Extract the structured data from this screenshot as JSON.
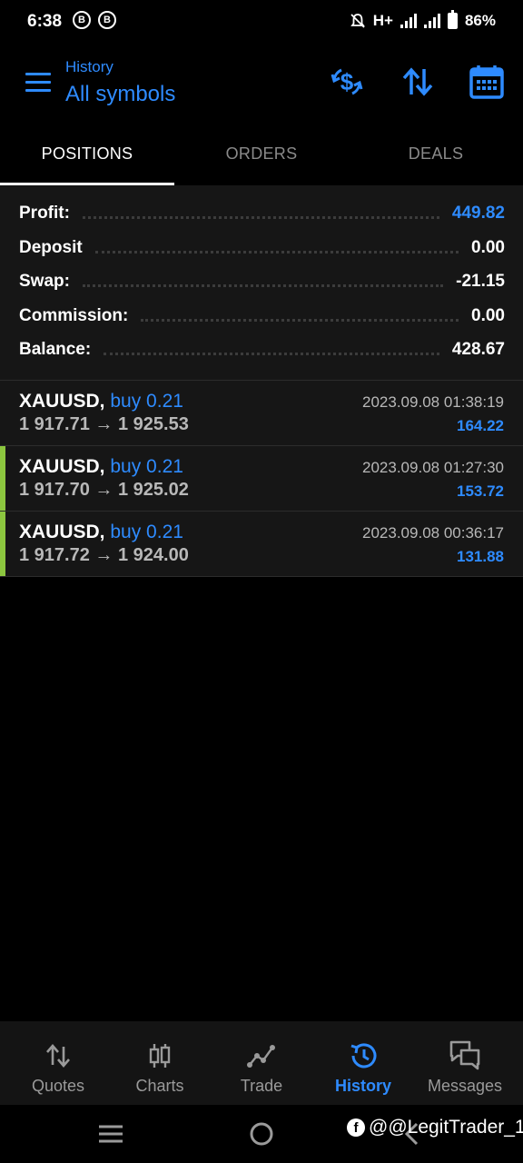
{
  "status_bar": {
    "time": "6:38",
    "badge_1": "B",
    "badge_2": "B",
    "network": "H+",
    "battery": "86%"
  },
  "header": {
    "subtitle": "History",
    "title": "All symbols",
    "icons": [
      "currency-exchange-icon",
      "sort-icon",
      "calendar-icon"
    ]
  },
  "tabs": [
    {
      "label": "POSITIONS",
      "active": true
    },
    {
      "label": "ORDERS",
      "active": false
    },
    {
      "label": "DEALS",
      "active": false
    }
  ],
  "summary": {
    "profit_label": "Profit:",
    "profit_value": "449.82",
    "deposit_label": "Deposit",
    "deposit_value": "0.00",
    "swap_label": "Swap:",
    "swap_value": "-21.15",
    "commission_label": "Commission:",
    "commission_value": "0.00",
    "balance_label": "Balance:",
    "balance_value": "428.67"
  },
  "deals": [
    {
      "symbol": "XAUUSD,",
      "side": "buy 0.21",
      "prices": "1 917.71 → 1 925.53",
      "datetime": "2023.09.08 01:38:19",
      "profit": "164.22"
    },
    {
      "symbol": "XAUUSD,",
      "side": "buy 0.21",
      "prices": "1 917.70 → 1 925.02",
      "datetime": "2023.09.08 01:27:30",
      "profit": "153.72"
    },
    {
      "symbol": "XAUUSD,",
      "side": "buy 0.21",
      "prices": "1 917.72 → 1 924.00",
      "datetime": "2023.09.08 00:36:17",
      "profit": "131.88"
    }
  ],
  "bottom_nav": [
    {
      "label": "Quotes",
      "icon": "quotes-arrows-icon",
      "active": false
    },
    {
      "label": "Charts",
      "icon": "candlestick-icon",
      "active": false
    },
    {
      "label": "Trade",
      "icon": "trade-line-icon",
      "active": false
    },
    {
      "label": "History",
      "icon": "history-clock-icon",
      "active": true
    },
    {
      "label": "Messages",
      "icon": "chat-bubbles-icon",
      "active": false
    }
  ],
  "watermark": "@@LegitTrader_1",
  "colors": {
    "accent": "#2e8bff",
    "background": "#000000",
    "panel": "#161616",
    "marker": "#8cc63f"
  }
}
